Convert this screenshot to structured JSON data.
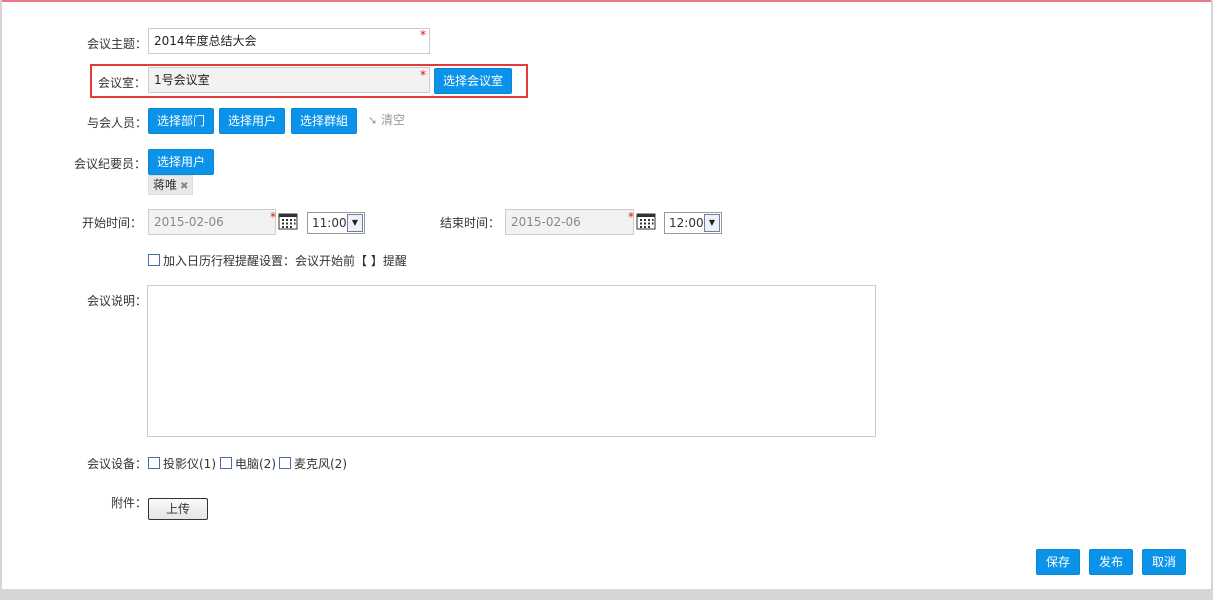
{
  "form": {
    "topic_label": "会议主题：",
    "topic_value": "2014年度总结大会",
    "room_label": "会议室：",
    "room_value": "1号会议室",
    "select_room_btn": "选择会议室",
    "attendees_label": "与会人员：",
    "select_dept_btn": "选择部门",
    "select_user_btn": "选择用户",
    "select_group_btn": "选择群組",
    "clear_label": "清空",
    "recorder_label": "会议纪要员：",
    "recorder_select_btn": "选择用户",
    "recorder_tag": "蒋唯",
    "start_label": "开始时间：",
    "start_date": "2015-02-06",
    "start_time": "11:00",
    "end_label": "结束时间：",
    "end_date": "2015-02-06",
    "end_time": "12:00",
    "calendar_reminder": "加入日历行程提醒设置：会议开始前【  】提醒",
    "desc_label": "会议说明：",
    "equipment_label": "会议设备：",
    "equipment": [
      {
        "name": "投影仪(1)"
      },
      {
        "name": "电脑(2)"
      },
      {
        "name": "麦克风(2)"
      }
    ],
    "attachment_label": "附件：",
    "upload_btn": "上传",
    "required_mark": "*"
  },
  "actions": {
    "save": "保存",
    "publish": "发布",
    "cancel": "取消"
  },
  "colors": {
    "primary_button": "#0a93e8",
    "highlight_border": "#e23b3b",
    "top_border": "#f0788c",
    "required": "#e01010"
  }
}
